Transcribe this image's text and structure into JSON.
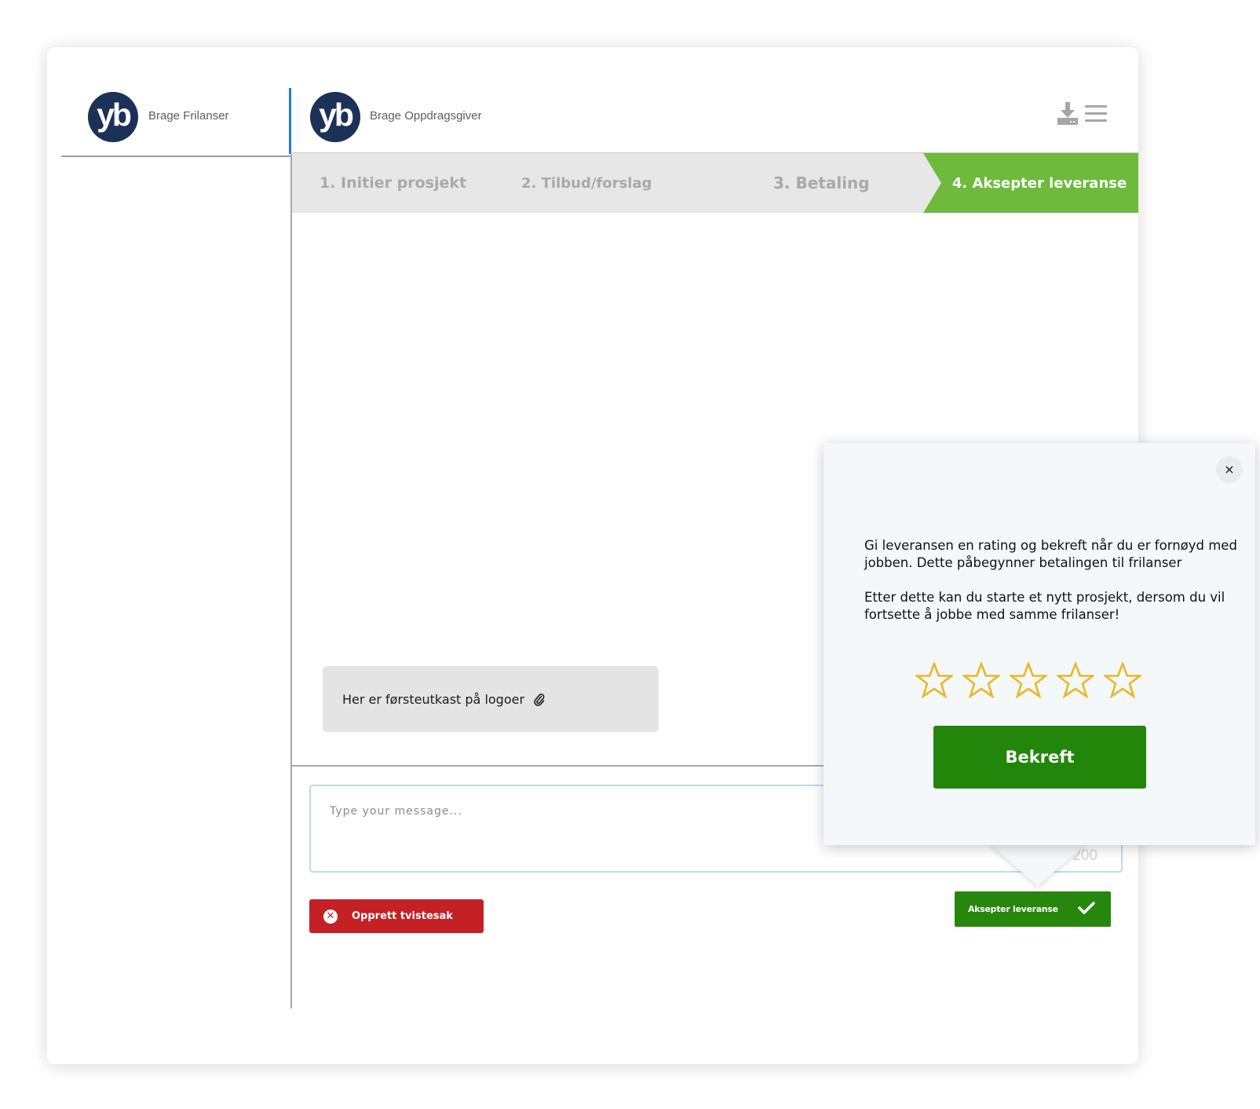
{
  "left_panel": {
    "avatar_initials": "yb",
    "user_name": "Brage Frilanser"
  },
  "chat_header": {
    "avatar_initials": "yb",
    "user_name": "Brage Oppdragsgiver"
  },
  "steps": [
    {
      "label": "1. Initier prosjekt",
      "active": false
    },
    {
      "label": "2. Tilbud/forslag",
      "active": false
    },
    {
      "label": "3. Betaling",
      "active": false
    },
    {
      "label": "4. Aksepter leveranse",
      "active": true
    }
  ],
  "messages": [
    {
      "text": "Her er førsteutkast på logoer",
      "has_attachment": true
    }
  ],
  "composer": {
    "placeholder": "Type your message...",
    "char_count": "200"
  },
  "actions": {
    "dispute_label": "Opprett tvistesak",
    "accept_label": "Aksepter leveranse"
  },
  "rating_popup": {
    "close_glyph": "×",
    "paragraph_1": "Gi leveransen en rating og bekreft når du er fornøyd med jobben. Dette påbegynner betalingen til frilanser",
    "paragraph_2": "Etter dette kan du starte et nytt prosjekt, dersom du vil fortsette å jobbe med samme frilanser!",
    "rating": {
      "value": 0,
      "max": 5
    },
    "confirm_label": "Bekreft"
  },
  "colors": {
    "brand_navy": "#1b3157",
    "step_active": "#6dba3d",
    "confirm_green": "#22860a",
    "dispute_red": "#c42026",
    "active_indicator": "#1f7ae0",
    "star_outline": "#e8b826"
  },
  "icons": {
    "download": "download-icon",
    "menu": "hamburger-menu-icon",
    "attachment": "paperclip-icon",
    "close": "close-icon",
    "check": "checkmark-icon",
    "error": "x-circle-icon",
    "star": "star-outline-icon"
  }
}
